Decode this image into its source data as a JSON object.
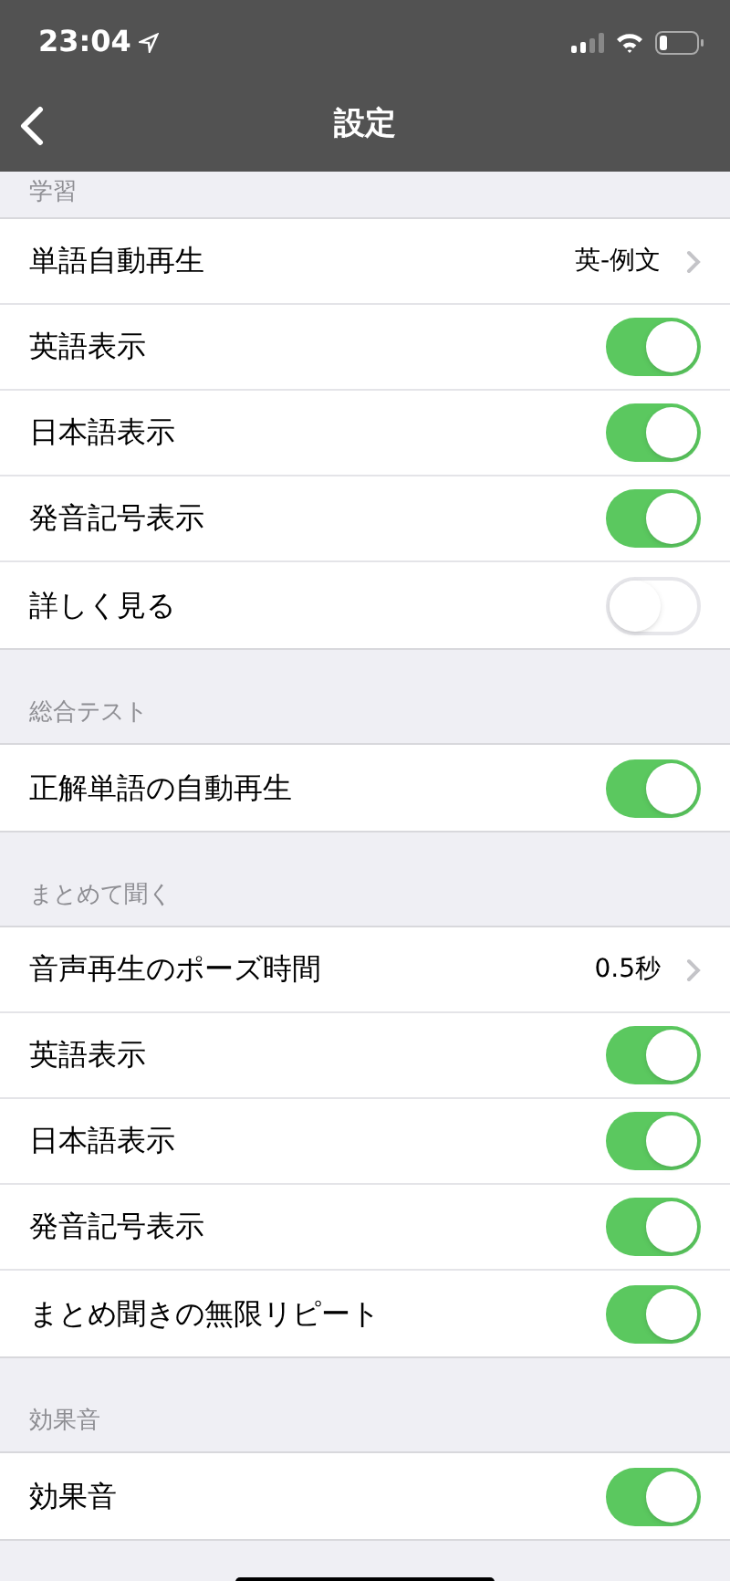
{
  "status_bar": {
    "time": "23:04"
  },
  "nav": {
    "title": "設定"
  },
  "sections": [
    {
      "header": "学習",
      "rows": [
        {
          "kind": "value",
          "label": "単語自動再生",
          "value": "英-例文"
        },
        {
          "kind": "toggle",
          "label": "英語表示",
          "on": true
        },
        {
          "kind": "toggle",
          "label": "日本語表示",
          "on": true
        },
        {
          "kind": "toggle",
          "label": "発音記号表示",
          "on": true
        },
        {
          "kind": "toggle",
          "label": "詳しく見る",
          "on": false
        }
      ]
    },
    {
      "header": "総合テスト",
      "rows": [
        {
          "kind": "toggle",
          "label": "正解単語の自動再生",
          "on": true
        }
      ]
    },
    {
      "header": "まとめて聞く",
      "rows": [
        {
          "kind": "value",
          "label": "音声再生のポーズ時間",
          "value": "0.5秒"
        },
        {
          "kind": "toggle",
          "label": "英語表示",
          "on": true
        },
        {
          "kind": "toggle",
          "label": "日本語表示",
          "on": true
        },
        {
          "kind": "toggle",
          "label": "発音記号表示",
          "on": true
        },
        {
          "kind": "toggle",
          "label": "まとめ聞きの無限リピート",
          "on": true
        }
      ]
    },
    {
      "header": "効果音",
      "rows": [
        {
          "kind": "toggle",
          "label": "効果音",
          "on": true
        }
      ]
    }
  ]
}
